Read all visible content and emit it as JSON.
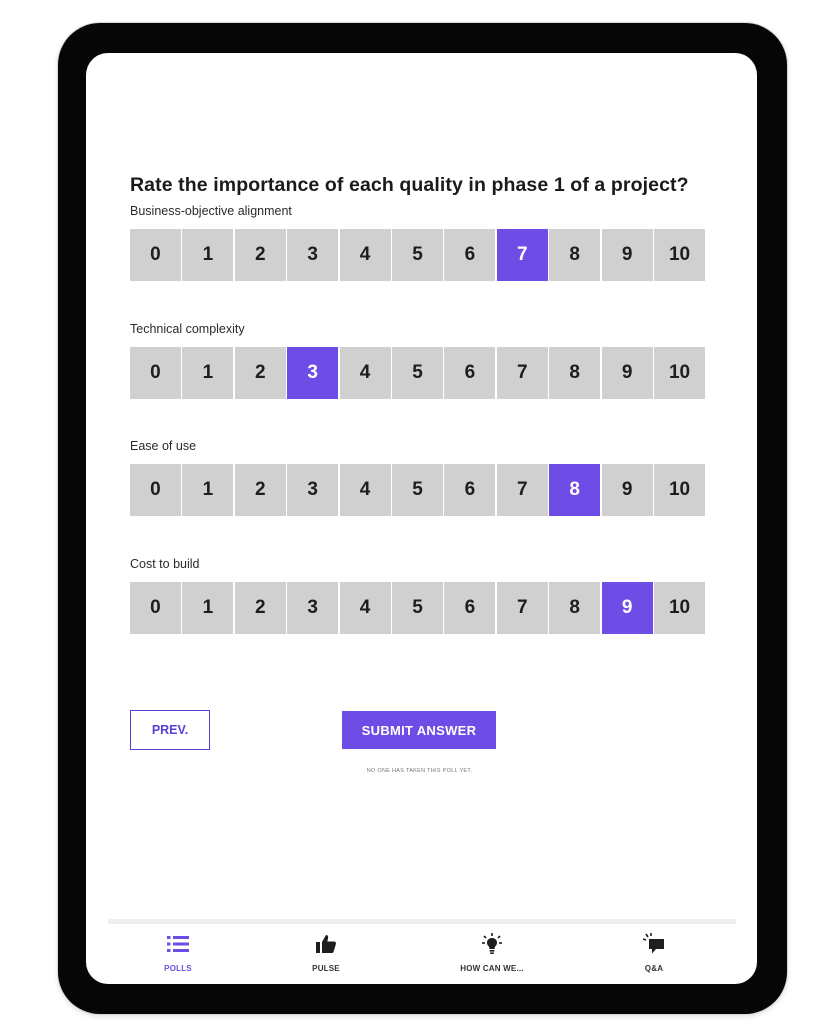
{
  "poll": {
    "question": "Rate the importance of each quality in phase 1 of a project?",
    "scale_values": [
      "0",
      "1",
      "2",
      "3",
      "4",
      "5",
      "6",
      "7",
      "8",
      "9",
      "10"
    ],
    "rows": [
      {
        "label": "Business-objective alignment",
        "selected": 7
      },
      {
        "label": "Technical complexity",
        "selected": 3
      },
      {
        "label": "Ease of use",
        "selected": 8
      },
      {
        "label": "Cost to build",
        "selected": 9
      }
    ]
  },
  "actions": {
    "prev_label": "PREV.",
    "submit_label": "SUBMIT ANSWER",
    "note": "NO ONE HAS TAKEN THIS POLL YET."
  },
  "tabbar": {
    "items": [
      {
        "label": "POLLS",
        "icon": "list-icon",
        "active": true
      },
      {
        "label": "PULSE",
        "icon": "thumbs-up-icon",
        "active": false
      },
      {
        "label": "HOW CAN WE...",
        "icon": "lightbulb-icon",
        "active": false
      },
      {
        "label": "Q&A",
        "icon": "chat-bubble-icon",
        "active": false
      }
    ]
  },
  "colors": {
    "accent": "#6e4de6",
    "cell_bg": "#d0d0d0",
    "device_frame": "#060606"
  }
}
